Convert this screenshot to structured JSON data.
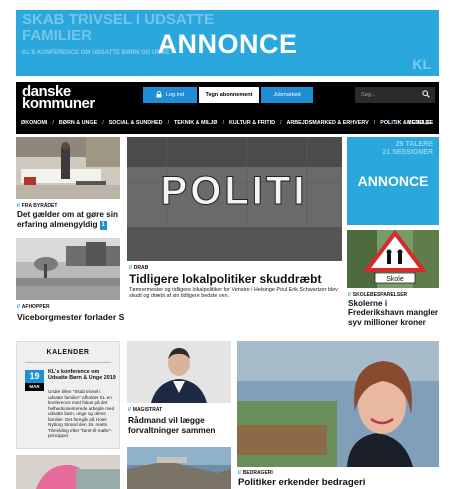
{
  "top_ad": {
    "label": "ANNONCE",
    "ghost_text": "SKAB TRIVSEL I UDSATTE FAMILIER",
    "ghost_sub": "KL'S KONFERENCE OM UDSATTE BØRN OG UNGE",
    "ghost_brand": "KL"
  },
  "header": {
    "logo_line1": "danske",
    "logo_line2": "kommuner",
    "login_label": "Log ind",
    "subscribe_label": "Tegn abonnement",
    "jobs_label": "Jobmarked",
    "search_placeholder": "Søg...",
    "nav_items": [
      "ØKONOMI",
      "BØRN & UNGE",
      "SOCIAL & SUNDHED",
      "TEKNIK & MILJØ",
      "KULTUR & FRITID",
      "ARBEJDSMARKED & ERHVERV",
      "POLITIK & LEDELSE"
    ],
    "menu_label": "MENU"
  },
  "articles": {
    "a1": {
      "kicker": "FRA BYRÅDET",
      "headline": "Det gælder om at gøre sin erfaring almengyldig",
      "badge": "1"
    },
    "a2": {
      "kicker": "DRAB",
      "headline": "Tidligere lokalpolitiker skuddræbt",
      "summary": "Tømrermester og tidligere lokalpolitiker for Venstre i Helsinge Poul Erik Schwartzer blev skudt og dræbt af sin tidligere bedste ven.",
      "photo_text": "POLITI"
    },
    "a3": {
      "kicker": "AFHOPPER",
      "headline": "Viceborgmester forlader S"
    },
    "a4": {
      "kicker": "SKOLEBESPARELSER",
      "headline": "Skolerne i Frederikshavn mangler syv millioner kroner",
      "sign_text": "Skole"
    },
    "a5": {
      "kicker": "MAGISTRAT",
      "headline": "Rådmand vil lægge forvaltninger sammen"
    },
    "a6": {
      "kicker": "BEDRAGERI",
      "headline": "Politiker erkender bedrageri"
    }
  },
  "side_ad": {
    "label": "ANNONCE",
    "ghost_text_1": "29 TALERE",
    "ghost_text_2": "21 SESSIONER"
  },
  "calendar": {
    "title": "KALENDER",
    "day": "19",
    "month": "MAR",
    "event_title": "KL's konference om Udsatte Børn & Unge 2019",
    "event_text": "Under titlen \"Skab trivsel i udsatte familier\" afholder KL en konference med fokus på det helhedsorienterede arbejde med udsatte børn, unge og deres familier. Det foregår på Hotel Nyborg Strand den 19. marts. Tilmelding efter \"først-til-mølle\"-princippet."
  },
  "colors": {
    "accent": "#1e8fd6",
    "ad_blue": "#2aa7dc",
    "header_bg": "#000000"
  }
}
